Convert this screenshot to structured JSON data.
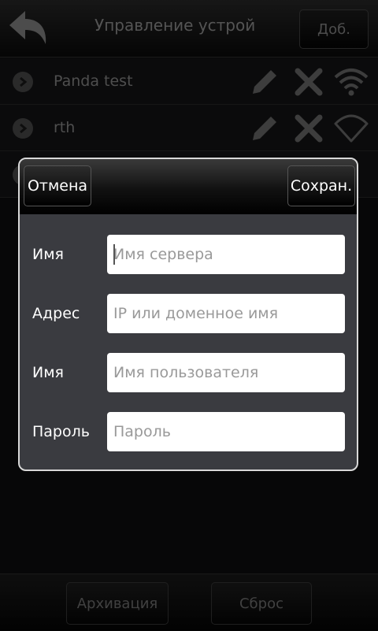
{
  "header": {
    "title": "Управление устрой",
    "add_label": "Доб."
  },
  "devices": [
    {
      "name": "Panda test",
      "status": "online"
    },
    {
      "name": "rth",
      "status": "offline"
    }
  ],
  "bottom": {
    "archive_label": "Архивация",
    "reset_label": "Сброс"
  },
  "dialog": {
    "cancel_label": "Отмена",
    "save_label": "Сохран.",
    "fields": [
      {
        "label": "Имя",
        "placeholder": "Имя сервера",
        "value": ""
      },
      {
        "label": "Адрес",
        "placeholder": "IP или доменное имя",
        "value": ""
      },
      {
        "label": "Имя",
        "placeholder": "Имя пользователя",
        "value": ""
      },
      {
        "label": "Пароль",
        "placeholder": "Пароль",
        "value": ""
      }
    ]
  },
  "icons": {
    "back": "back-arrow-icon",
    "row_arrow": "chevron-right-icon",
    "edit": "pencil-icon",
    "delete": "x-icon",
    "wifi_on": "wifi-icon",
    "wifi_off": "wifi-outline-icon"
  },
  "colors": {
    "dialog_bg": "#3a3b40",
    "dialog_border": "#d8d8d8",
    "background": "#0d0d0f",
    "icon_gray": "#6f6f6f"
  }
}
